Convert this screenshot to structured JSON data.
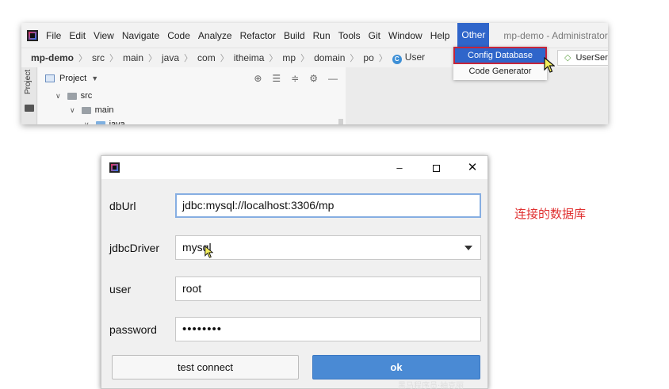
{
  "ide": {
    "menu": [
      "File",
      "Edit",
      "View",
      "Navigate",
      "Code",
      "Analyze",
      "Refactor",
      "Build",
      "Run",
      "Tools",
      "Git",
      "Window",
      "Help"
    ],
    "active_menu": "Other",
    "window_title": "mp-demo - Administrator",
    "breadcrumbs": [
      "mp-demo",
      "src",
      "main",
      "java",
      "com",
      "itheima",
      "mp",
      "domain",
      "po"
    ],
    "breadcrumb_class": "User",
    "other_menu": {
      "items": [
        "Config Database",
        "Code Generator"
      ],
      "selected": "Config Database"
    },
    "editor_tab": "UserSer",
    "side_tool_label": "Project",
    "project_panel": {
      "title": "Project",
      "tree": [
        {
          "label": "src",
          "depth": 1
        },
        {
          "label": "main",
          "depth": 2
        },
        {
          "label": "java",
          "depth": 3
        }
      ]
    },
    "colors": {
      "accent": "#2f65ca",
      "highlight_outline": "#c6243a"
    }
  },
  "dialog": {
    "fields": {
      "dbUrl": {
        "label": "dbUrl",
        "value": "jdbc:mysql://localhost:3306/mp"
      },
      "jdbcDriver": {
        "label": "jdbcDriver",
        "value": "mysql"
      },
      "user": {
        "label": "user",
        "value": "root"
      },
      "password": {
        "label": "password",
        "value": "••••••••"
      }
    },
    "buttons": {
      "test": "test connect",
      "ok": "ok"
    },
    "window_controls": {
      "minimize": "–",
      "close": "✕"
    },
    "colors": {
      "ok_button": "#4a8ad4",
      "focus_border": "#86aee2"
    }
  },
  "annotation": {
    "text": "连接的数据库",
    "color": "#e03131"
  },
  "watermark": "黑马程序员·袖克丽"
}
